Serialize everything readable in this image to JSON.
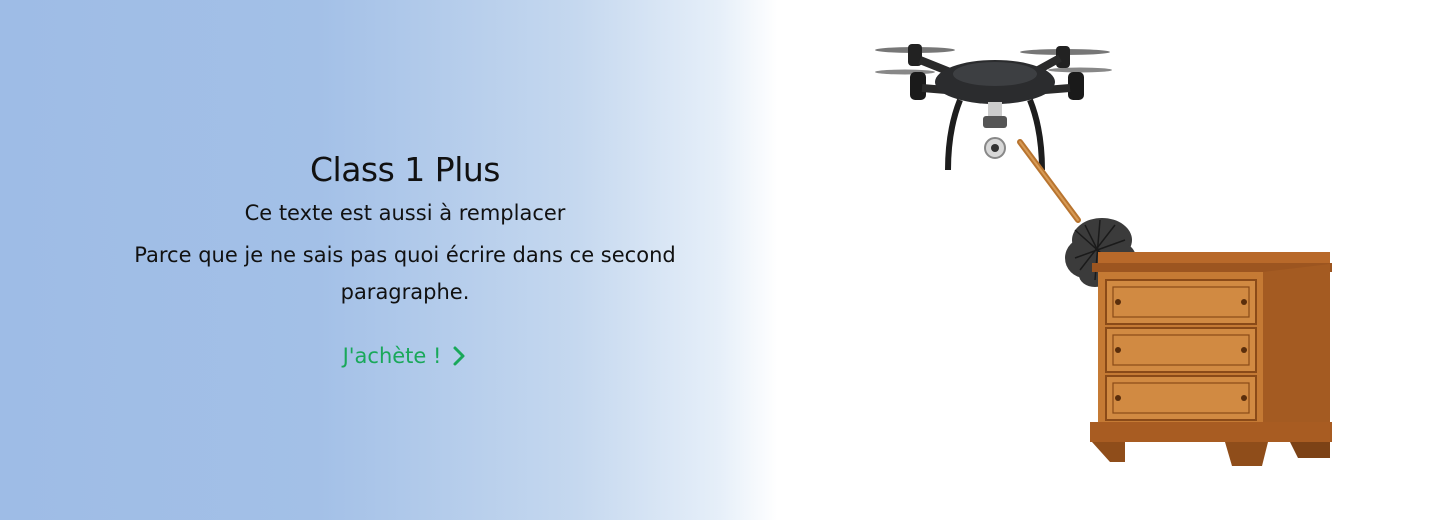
{
  "hero": {
    "title": "Class 1 Plus",
    "subtitle": "Ce texte est aussi à remplacer",
    "paragraph": "Parce que je ne sais pas quoi écrire dans ce second paragraphe.",
    "cta_label": "J'achète !",
    "cta_icon": "chevron-right-icon"
  },
  "colors": {
    "gradient_start": "#9ebce6",
    "cta": "#19a85a",
    "text": "#111111"
  },
  "illustration": {
    "subjects": [
      "drone-image",
      "feather-duster-image",
      "dresser-image"
    ]
  }
}
